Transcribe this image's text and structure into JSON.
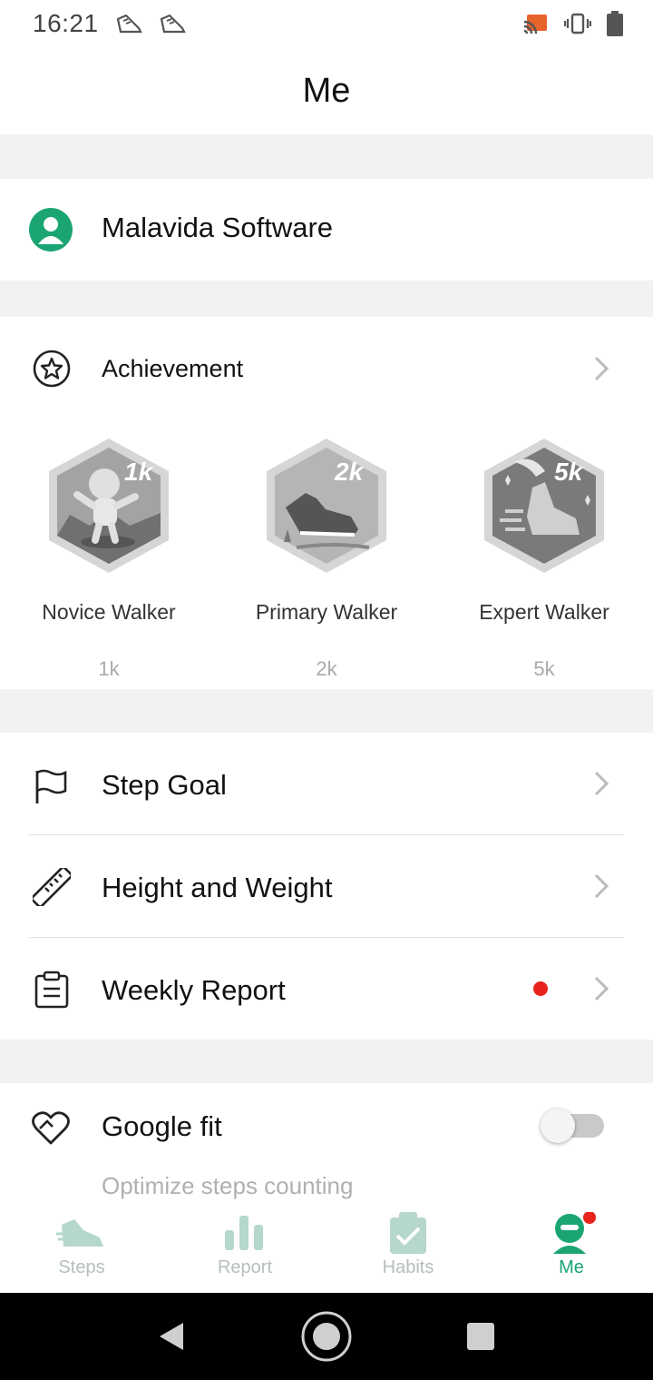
{
  "status": {
    "time": "16:21"
  },
  "header": {
    "title": "Me"
  },
  "profile": {
    "name": "Malavida Software"
  },
  "achievement": {
    "label": "Achievement",
    "badges": [
      {
        "name": "Novice Walker",
        "value": "1k",
        "tag": "1k"
      },
      {
        "name": "Primary Walker",
        "value": "2k",
        "tag": "2k"
      },
      {
        "name": "Expert Walker",
        "value": "5k",
        "tag": "5k"
      }
    ]
  },
  "settings": {
    "step_goal": "Step Goal",
    "height_weight": "Height and Weight",
    "weekly_report": "Weekly Report"
  },
  "google_fit": {
    "label": "Google fit",
    "subtitle": "Optimize steps counting",
    "enabled": false
  },
  "tabs": [
    {
      "label": "Steps",
      "icon": "shoe-icon"
    },
    {
      "label": "Report",
      "icon": "bar-chart-icon"
    },
    {
      "label": "Habits",
      "icon": "clipboard-check-icon"
    },
    {
      "label": "Me",
      "icon": "person-icon",
      "active": true
    }
  ],
  "colors": {
    "accent": "#1aa572",
    "badge_dot": "#e8231b",
    "inactive_tab": "#b5c0bd"
  }
}
